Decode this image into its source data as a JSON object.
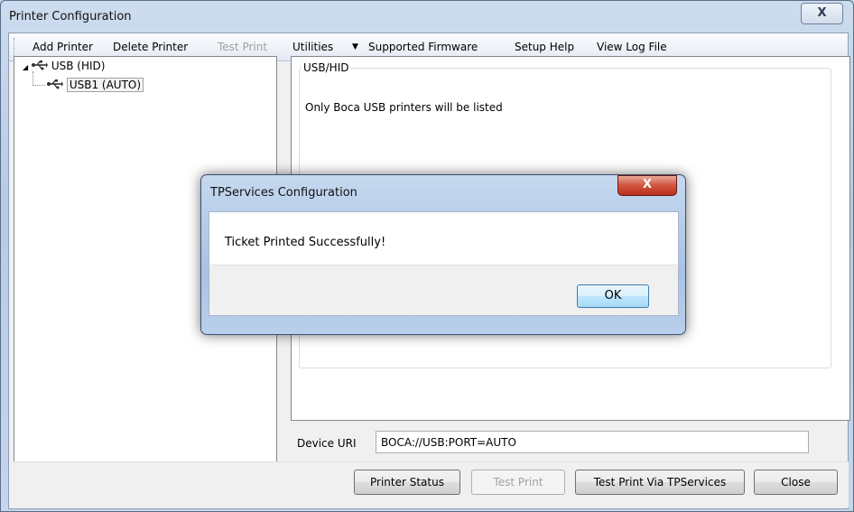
{
  "window": {
    "title": "Printer Configuration",
    "close_glyph": "X"
  },
  "toolbar": {
    "items": [
      {
        "label": "Add Printer",
        "enabled": true
      },
      {
        "label": "Delete Printer",
        "enabled": true
      },
      {
        "label": "Test Print",
        "enabled": false
      },
      {
        "label": "Utilities",
        "enabled": true
      },
      {
        "label": "Supported Firmware",
        "enabled": true,
        "prefix_glyph": "▼"
      },
      {
        "label": "Setup Help",
        "enabled": true
      },
      {
        "label": "View Log File",
        "enabled": true
      }
    ]
  },
  "tree": {
    "root": {
      "label": "USB (HID)",
      "expanded": true,
      "icon": "usb-icon"
    },
    "child": {
      "label": "USB1 (AUTO)",
      "selected": true,
      "icon": "usb-icon"
    }
  },
  "panel": {
    "group_title": "USB/HID",
    "message": "Only Boca USB printers will be listed"
  },
  "device": {
    "label": "Device URI",
    "value": "BOCA://USB:PORT=AUTO"
  },
  "buttons": {
    "printer_status": "Printer Status",
    "test_print": "Test Print",
    "test_print_via": "Test Print Via TPServices",
    "close": "Close"
  },
  "dialog": {
    "title": "TPServices Configuration",
    "close_glyph": "X",
    "message": "Ticket Printed Successfully!",
    "ok": "OK"
  }
}
